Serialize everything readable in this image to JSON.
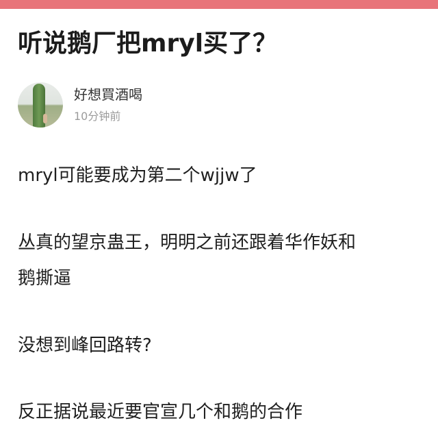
{
  "post": {
    "title": "听说鹅厂把mryl买了？",
    "author": {
      "name": "好想買酒喝",
      "time": "10分钟前"
    },
    "paragraphs": [
      "mryl可能要成为第二个wjjw了",
      "丛真的望京蛊王，明明之前还跟着华作妖和",
      "鹅撕逼",
      "没想到峰回路转?",
      "反正据说最近要官宣几个和鹅的合作"
    ]
  },
  "colors": {
    "accent_bar": "#e8747a",
    "time_text": "#9b9b9b"
  }
}
